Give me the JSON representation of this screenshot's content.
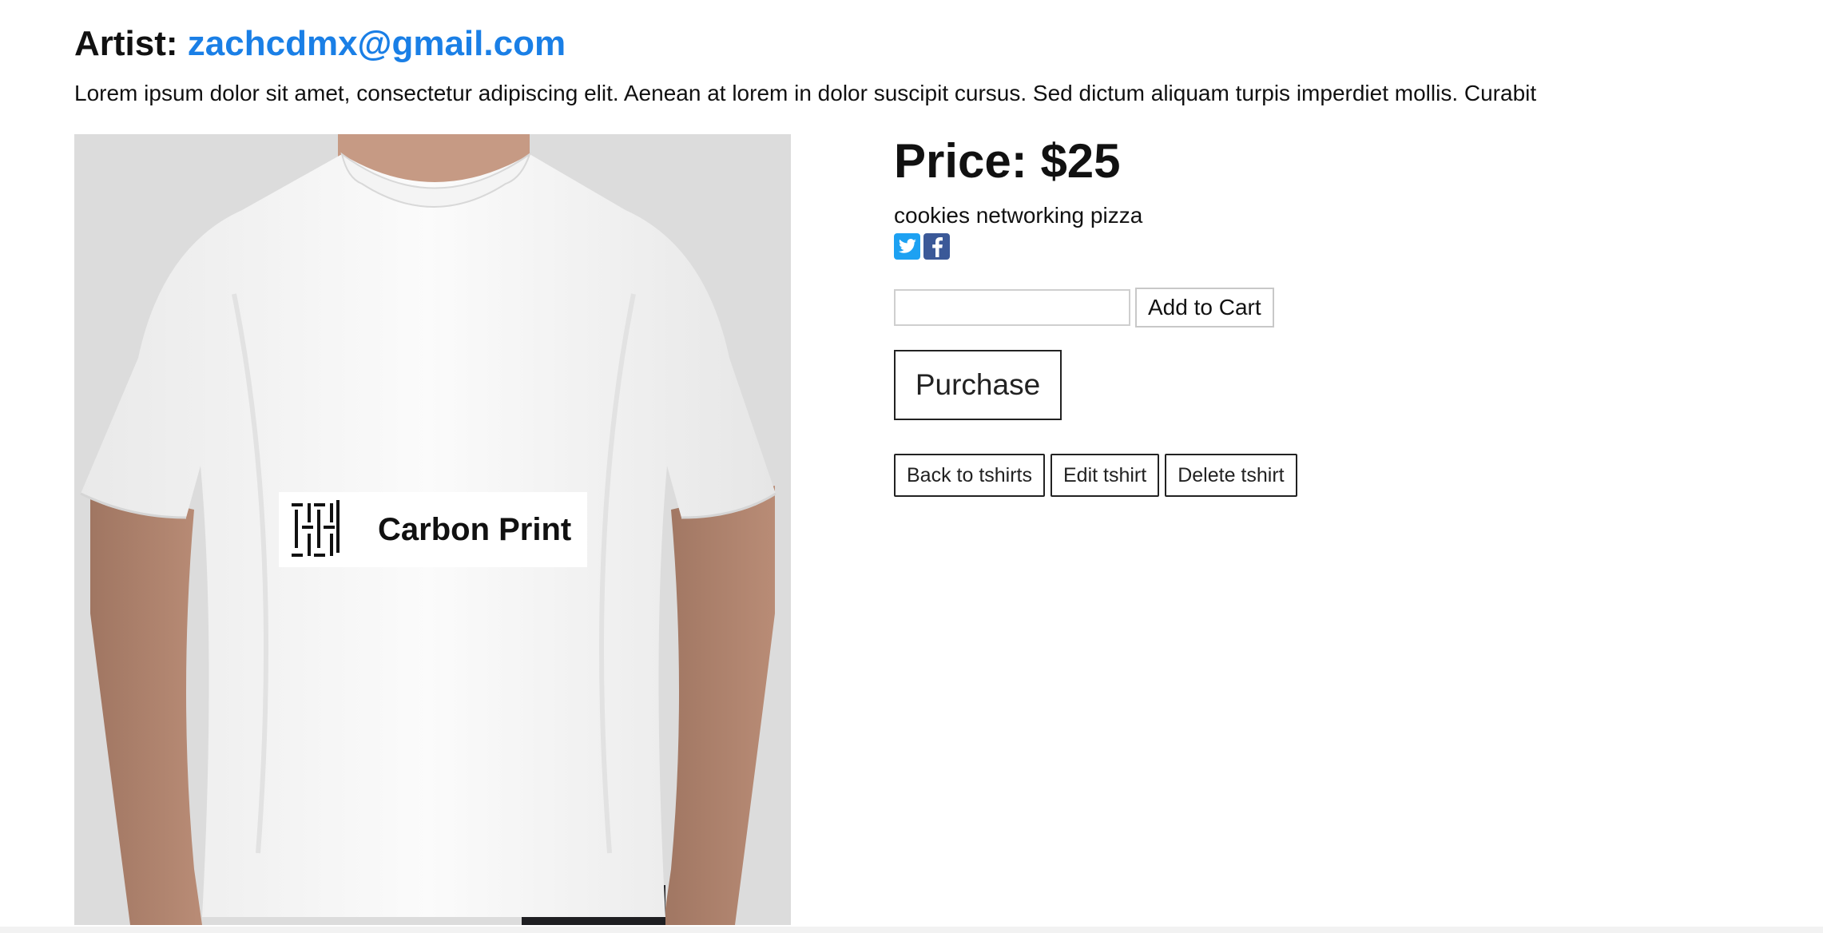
{
  "header": {
    "artist_label": "Artist:",
    "artist_email": "zachcdmx@gmail.com",
    "description": "Lorem ipsum dolor sit amet, consectetur adipiscing elit. Aenean at lorem in dolor suscipit cursus. Sed dictum aliquam turpis imperdiet mollis. Curabit"
  },
  "product": {
    "image_logo_text": "Carbon Print",
    "price_label": "Price:",
    "price_value": "$25",
    "tags": "cookies networking pizza"
  },
  "social": {
    "icons": [
      "twitter-icon",
      "facebook-icon"
    ],
    "colors": {
      "twitter": "#1da1f2",
      "facebook": "#3b5998"
    }
  },
  "cart": {
    "quantity_value": "",
    "add_to_cart_label": "Add to Cart",
    "purchase_label": "Purchase"
  },
  "actions": {
    "back_label": "Back to tshirts",
    "edit_label": "Edit tshirt",
    "delete_label": "Delete tshirt"
  },
  "colors": {
    "link": "#1a7fe6",
    "image_background": "#dcdcdc"
  }
}
